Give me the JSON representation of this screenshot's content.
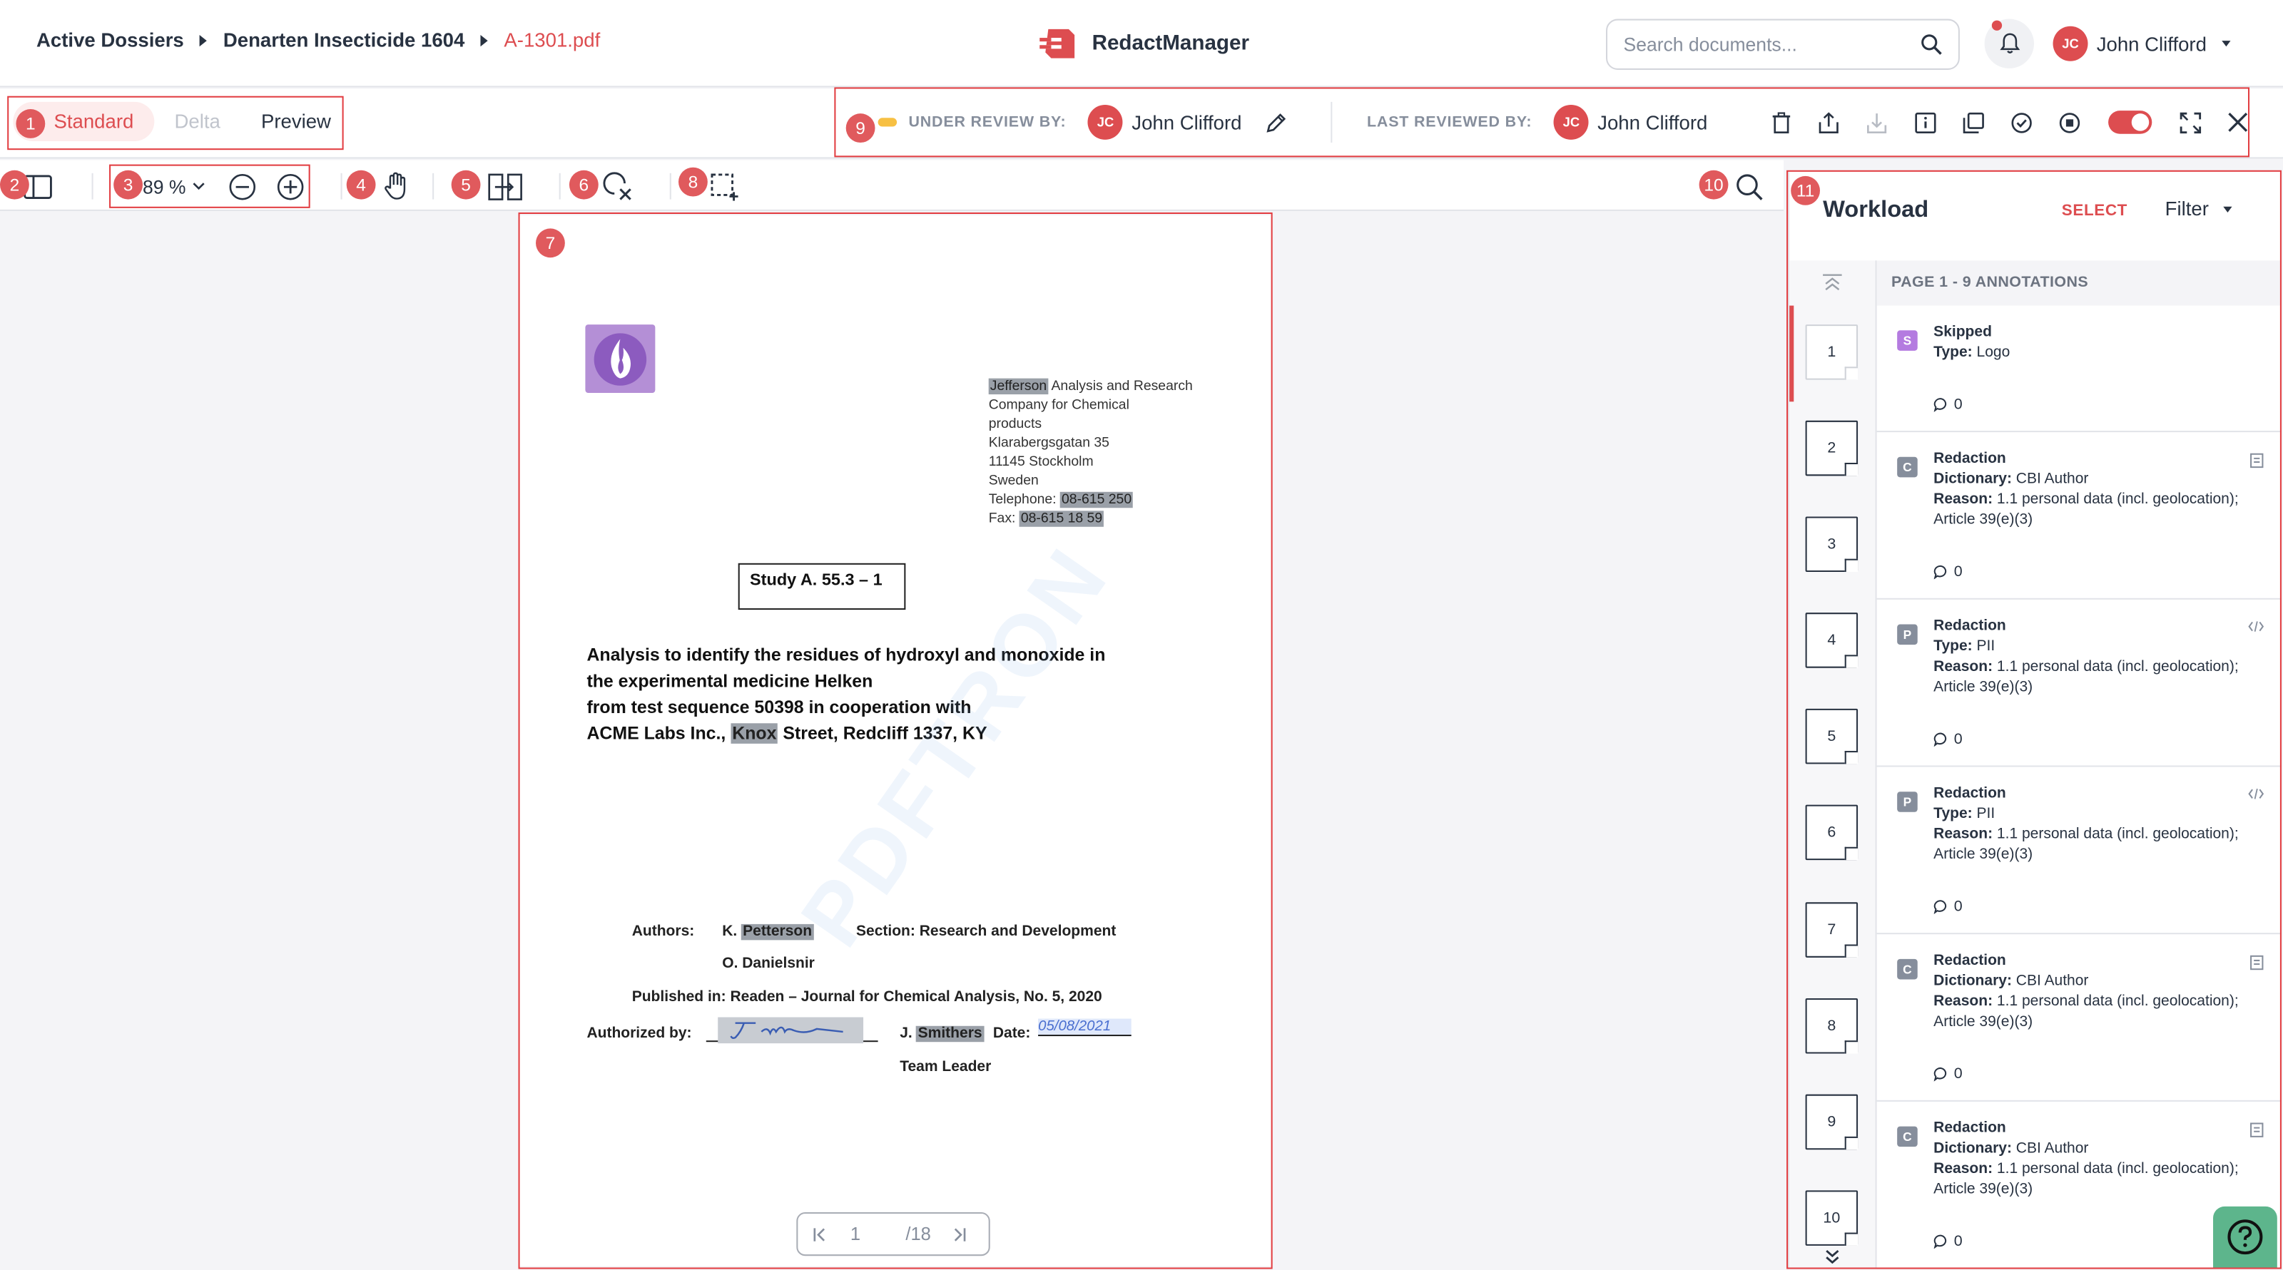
{
  "breadcrumb": [
    "Active Dossiers",
    "Denarten Insecticide 1604",
    "A-1301.pdf"
  ],
  "app_name": "RedactManager",
  "search": {
    "placeholder": "Search documents..."
  },
  "user": {
    "initials": "JC",
    "name": "John Clifford"
  },
  "view_modes": [
    "Standard",
    "Delta",
    "Preview"
  ],
  "status": {
    "under_review_label": "UNDER REVIEW BY:",
    "under_review_user": "John Clifford",
    "last_reviewed_label": "LAST REVIEWED BY:",
    "last_reviewed_user": "John Clifford",
    "toggle_on": true
  },
  "toolbar": {
    "zoom": "89 %"
  },
  "document": {
    "address": {
      "line1_hl": "Jefferson",
      "line1_rest": " Analysis and Research",
      "line2": "Company for Chemical",
      "line3": "products",
      "line4": "Klarabergsgatan 35",
      "line5": "11145 Stockholm",
      "line6": "Sweden",
      "tel_label": "Telephone: ",
      "tel_value": "08-615 250",
      "fax_label": "Fax: ",
      "fax_value": "08-615 18 59"
    },
    "study": "Study A. 55.3 – 1",
    "title_lines": [
      "Analysis to identify the residues of hydroxyl and monoxide in",
      "the experimental medicine Helken",
      "from test sequence 50398 in cooperation with"
    ],
    "title_last_pre": "ACME Labs Inc., ",
    "title_last_hl": "Knox",
    "title_last_post": " Street, Redcliff 1337, KY",
    "authors_label": "Authors:",
    "author1_pre": "K. ",
    "author1_hl": "Petterson",
    "author2": "O. Danielsnir",
    "section": "Section: Research and Development",
    "published": "Published in: Readen – Journal for Chemical Analysis, No. 5, 2020",
    "authorized_label": "Authorized by:",
    "signer_pre": "J. ",
    "signer_hl": "Smithers",
    "date_label": "Date:",
    "date_value": "05/08/2021",
    "team_leader": "Team Leader",
    "watermark": "PDFTRON"
  },
  "pager": {
    "current": "1",
    "total": "/18"
  },
  "workload": {
    "title": "Workload",
    "select": "SELECT",
    "filter": "Filter",
    "page_header": "PAGE 1 - 9 ANNOTATIONS",
    "thumbs": [
      "1",
      "2",
      "3",
      "4",
      "5",
      "6",
      "7",
      "8",
      "9",
      "10"
    ],
    "annotations": [
      {
        "badge": "S",
        "badge_color": "#b47be0",
        "l1b": "Skipped",
        "l2b": "Type:",
        "l2": " Logo",
        "l3b": "",
        "l3": "",
        "count": "0",
        "icon": ""
      },
      {
        "badge": "C",
        "badge_color": "#868e9c",
        "l1b": "Redaction",
        "l2b": "Dictionary:",
        "l2": " CBI Author",
        "l3b": "Reason:",
        "l3": " 1.1 personal data (incl. geolocation); Article 39(e)(3)",
        "count": "0",
        "icon": "doc"
      },
      {
        "badge": "P",
        "badge_color": "#868e9c",
        "l1b": "Redaction",
        "l2b": "Type:",
        "l2": " PII",
        "l3b": "Reason:",
        "l3": " 1.1 personal data (incl. geolocation); Article 39(e)(3)",
        "count": "0",
        "icon": "code"
      },
      {
        "badge": "P",
        "badge_color": "#868e9c",
        "l1b": "Redaction",
        "l2b": "Type:",
        "l2": " PII",
        "l3b": "Reason:",
        "l3": " 1.1 personal data (incl. geolocation); Article 39(e)(3)",
        "count": "0",
        "icon": "code"
      },
      {
        "badge": "C",
        "badge_color": "#868e9c",
        "l1b": "Redaction",
        "l2b": "Dictionary:",
        "l2": " CBI Author",
        "l3b": "Reason:",
        "l3": " 1.1 personal data (incl. geolocation); Article 39(e)(3)",
        "count": "0",
        "icon": "doc"
      },
      {
        "badge": "C",
        "badge_color": "#868e9c",
        "l1b": "Redaction",
        "l2b": "Dictionary:",
        "l2": " CBI Author",
        "l3b": "Reason:",
        "l3": " 1.1 personal data (incl. geolocation); Article 39(e)(3)",
        "count": "0",
        "icon": "doc"
      }
    ]
  },
  "callouts": [
    "1",
    "2",
    "3",
    "4",
    "5",
    "6",
    "7",
    "8",
    "9",
    "10",
    "11"
  ],
  "colors": {
    "accent": "#dd4d50",
    "callout": "#e23d41",
    "help": "#5db58c"
  }
}
